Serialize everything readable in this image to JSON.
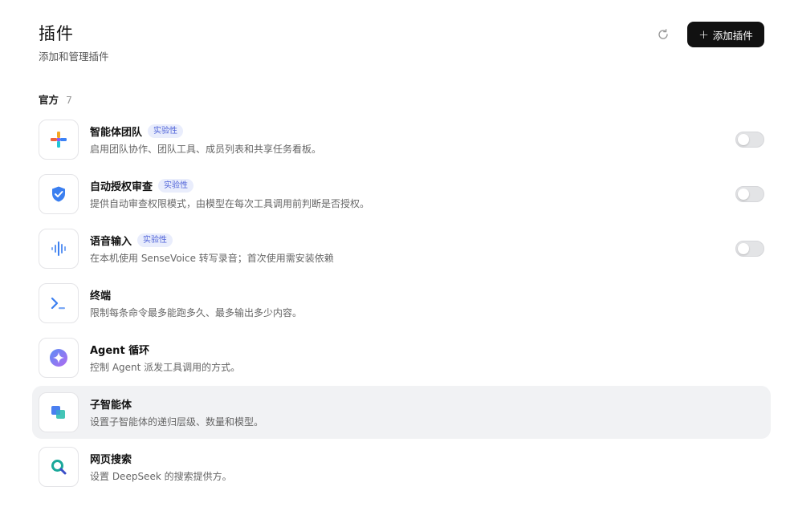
{
  "header": {
    "title": "插件",
    "subtitle": "添加和管理插件",
    "add_button_label": "添加插件",
    "add_button_plus": "+"
  },
  "section": {
    "title": "官方",
    "count": "7"
  },
  "plugins": [
    {
      "title": "智能体团队",
      "badge": "实验性",
      "desc": "启用团队协作、团队工具、成员列表和共享任务看板。",
      "icon": "team-puzzle-icon",
      "enabled": false
    },
    {
      "title": "自动授权审查",
      "badge": "实验性",
      "desc": "提供自动审查权限模式，由模型在每次工具调用前判断是否授权。",
      "icon": "shield-check-icon",
      "enabled": false
    },
    {
      "title": "语音输入",
      "badge": "实验性",
      "desc": "在本机使用 SenseVoice 转写录音；首次使用需安装依赖",
      "icon": "waveform-icon",
      "enabled": false
    },
    {
      "title": "终端",
      "desc": "限制每条命令最多能跑多久、最多输出多少内容。",
      "icon": "terminal-icon"
    },
    {
      "title": "Agent 循环",
      "desc": "控制 Agent 派发工具调用的方式。",
      "icon": "sparkle-icon"
    },
    {
      "title": "子智能体",
      "desc": "设置子智能体的递归层级、数量和模型。",
      "icon": "stacked-squares-icon",
      "active": true
    },
    {
      "title": "网页搜索",
      "desc": "设置 DeepSeek 的搜索提供方。",
      "icon": "search-icon"
    }
  ],
  "colors": {
    "accent": "#111111",
    "badge_text": "#4f63d8",
    "badge_bg": "#e9edfc",
    "active_row": "#f1f2f4",
    "toggle_off": "#e3e4e6"
  }
}
